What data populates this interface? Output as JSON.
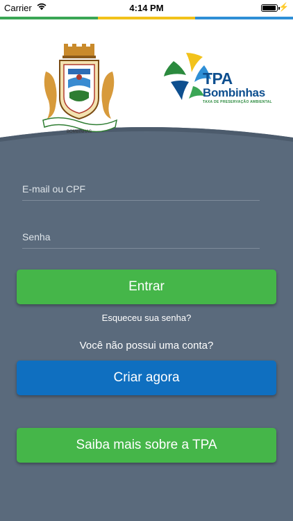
{
  "status_bar": {
    "carrier": "Carrier",
    "time": "4:14 PM",
    "battery_level": 0.95
  },
  "colors": {
    "stripe": [
      "#3aa655",
      "#f2c21b",
      "#2f8fd6"
    ],
    "background": "#5a6a7c",
    "primary_green": "#45b649",
    "primary_blue": "#0f6fc0",
    "logo_blue": "#0e4f8f",
    "logo_green": "#2b8a3e"
  },
  "header": {
    "coat_of_arms_caption": "BOMBINHAS",
    "tpa_title": "TPA",
    "tpa_subtitle": "Bombinhas",
    "tpa_tagline": "TAXA DE PRESERVAÇÃO AMBIENTAL"
  },
  "login": {
    "email_placeholder": "E-mail ou CPF",
    "email_value": "",
    "password_placeholder": "Senha",
    "password_value": "",
    "submit_label": "Entrar",
    "forgot_label": "Esqueceu sua senha?"
  },
  "signup": {
    "prompt": "Você não possui uma conta?",
    "create_label": "Criar agora"
  },
  "info": {
    "learn_more_label": "Saiba mais sobre a TPA"
  }
}
